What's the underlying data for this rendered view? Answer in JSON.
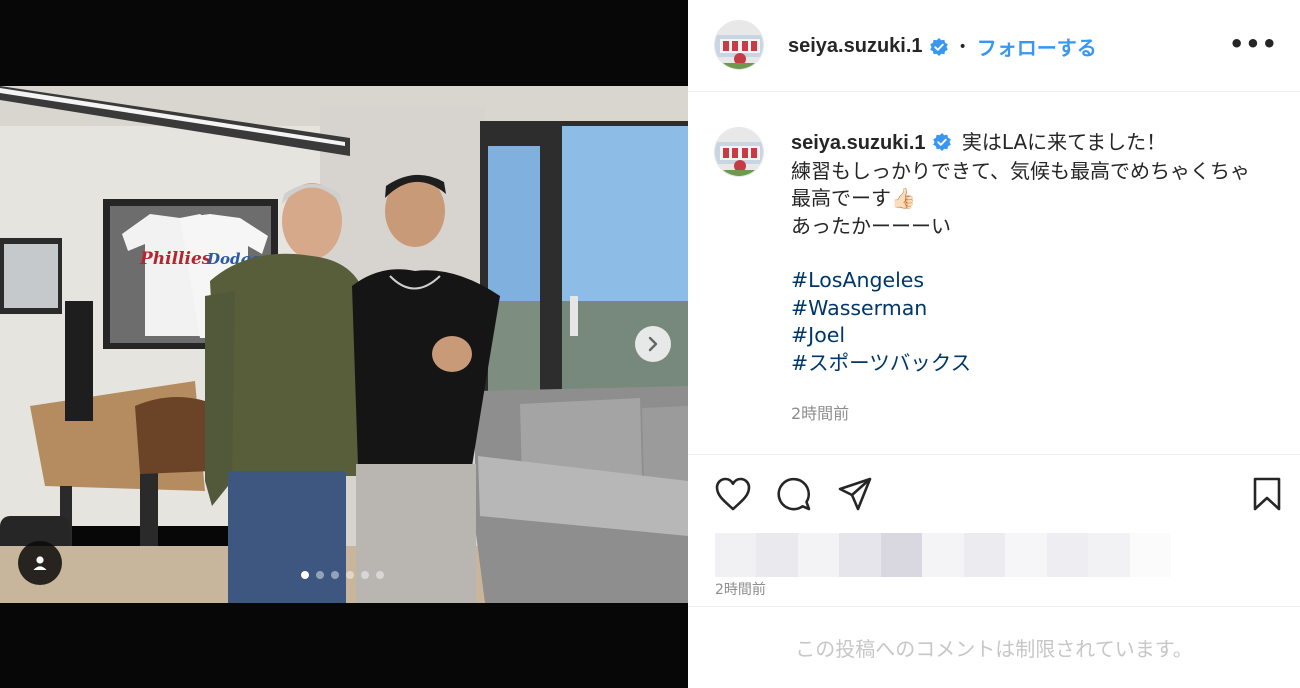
{
  "post": {
    "username": "seiya.suzuki.1",
    "follow_label": "フォローする",
    "separator": "•",
    "more_label": "•••",
    "caption_lines": [
      "実はLAに来てました！",
      "練習もしっかりできて、気候も最高でめちゃくちゃ",
      "最高でーす👍🏻",
      "あったかーーーい"
    ],
    "hashtags": [
      "#LosAngeles",
      "#Wasserman",
      "#Joel",
      "#スポーツバックス"
    ],
    "caption_time": "2時間前",
    "post_time": "2時間前",
    "comments_restricted": "この投稿へのコメントは制限されています。"
  },
  "carousel": {
    "slide_count": 6,
    "active_index": 0
  },
  "photo": {
    "jersey_left_text": "Phillies",
    "jersey_right_text": "Dodgers"
  },
  "icons": [
    "verified-badge-icon",
    "more-options-icon",
    "heart-icon",
    "comment-icon",
    "share-icon",
    "bookmark-icon",
    "chevron-right-icon",
    "user-tag-icon"
  ],
  "colors": {
    "follow": "#3897f0",
    "hashtag": "#00376b",
    "muted": "#8e8e8e",
    "verified": "#3897f0"
  }
}
